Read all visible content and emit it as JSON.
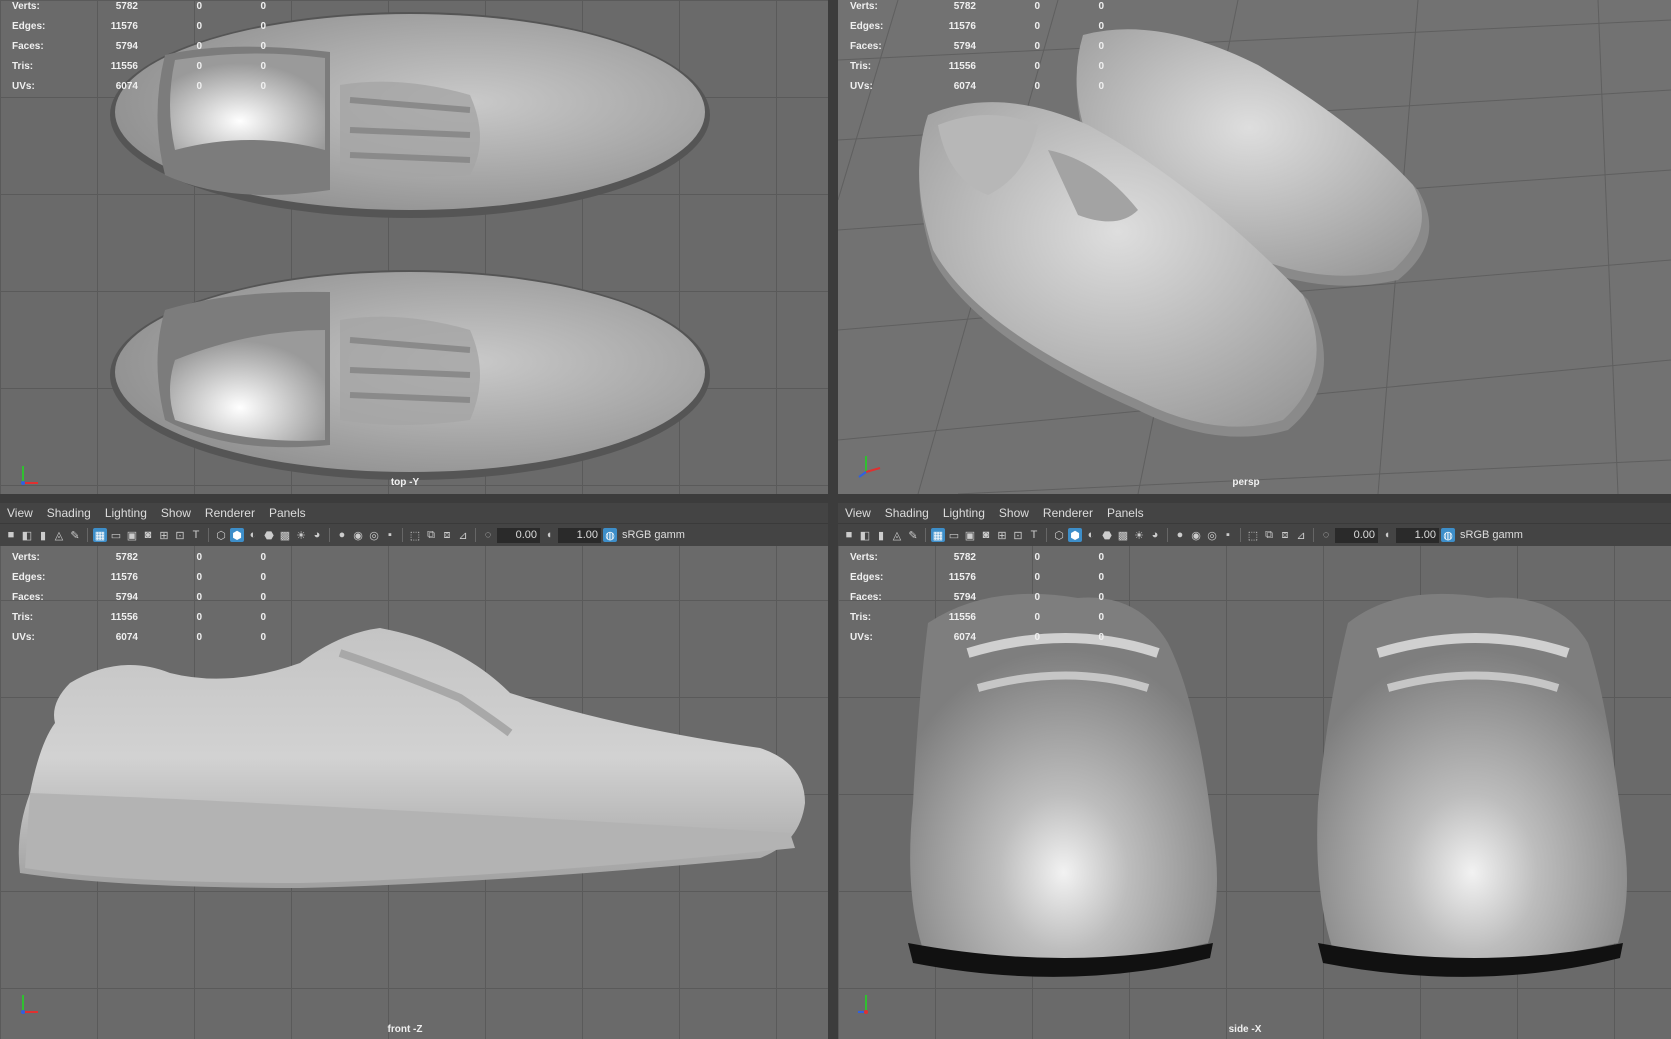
{
  "panel_menu": [
    "View",
    "Shading",
    "Lighting",
    "Show",
    "Renderer",
    "Panels"
  ],
  "toolbar": {
    "field_a": "0.00",
    "field_b": "1.00",
    "color_space": "sRGB gamm"
  },
  "hud_stats": [
    {
      "label": "Verts:",
      "v1": "5782",
      "v2": "0",
      "v3": "0"
    },
    {
      "label": "Edges:",
      "v1": "11576",
      "v2": "0",
      "v3": "0"
    },
    {
      "label": "Faces:",
      "v1": "5794",
      "v2": "0",
      "v3": "0"
    },
    {
      "label": "Tris:",
      "v1": "11556",
      "v2": "0",
      "v3": "0"
    },
    {
      "label": "UVs:",
      "v1": "6074",
      "v2": "0",
      "v3": "0"
    }
  ],
  "viewports": {
    "top": {
      "camera": "top -Y"
    },
    "persp": {
      "camera": "persp"
    },
    "front": {
      "camera": "front -Z"
    },
    "side": {
      "camera": "side -X"
    }
  },
  "axis_labels": {
    "y": "y",
    "x": "x",
    "z": "z"
  },
  "colors": {
    "active_icon": "#3d8ec9",
    "axis_x": "#e03030",
    "axis_y": "#30c030",
    "axis_z": "#3060e0"
  }
}
